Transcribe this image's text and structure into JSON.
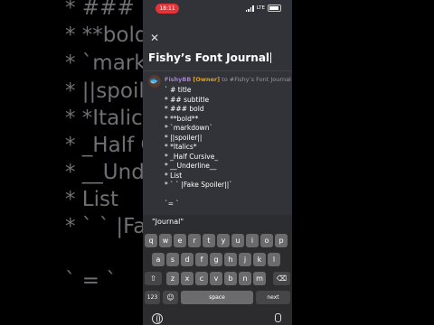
{
  "background_text": [
    "* ### bold",
    "* **bold**",
    "* `markdown`",
    "* ||spoiler||",
    "* *Italics*",
    "* _Half Cursive_",
    "* __Underline__",
    "* List",
    "* ` ` |Fake Spoiler||",
    "` = `"
  ],
  "status": {
    "time": "18:11",
    "network": "LTE"
  },
  "editor": {
    "close_icon": "close-icon",
    "title": "Fishy’s Font Journal",
    "author": "FishyBB",
    "role": "[Owner]",
    "reply_to": "to #Fishy’s Font Journal",
    "lines": [
      "` # title",
      "* ## subtitle",
      "* ### bold",
      "* **bold**",
      "* `markdown`",
      "* ||spoiler||",
      "* *Italics*",
      "* _Half Cursive_",
      "* __Underline__",
      "* List",
      "* ` ` |Fake Spoiler||`",
      "",
      "`= `"
    ]
  },
  "keyboard": {
    "suggestion": "\"Journal\"",
    "row1": [
      "q",
      "w",
      "e",
      "r",
      "t",
      "y",
      "u",
      "i",
      "o",
      "p"
    ],
    "row2": [
      "a",
      "s",
      "d",
      "f",
      "g",
      "h",
      "j",
      "k",
      "l"
    ],
    "row3": [
      "z",
      "x",
      "c",
      "v",
      "b",
      "n",
      "m"
    ],
    "shift_icon": "shift-icon",
    "delete_icon": "delete-icon",
    "num_label": "123",
    "emoji_icon": "emoji-icon",
    "space_label": "space",
    "next_label": "next",
    "globe_icon": "globe-icon",
    "mic_icon": "microphone-icon"
  }
}
